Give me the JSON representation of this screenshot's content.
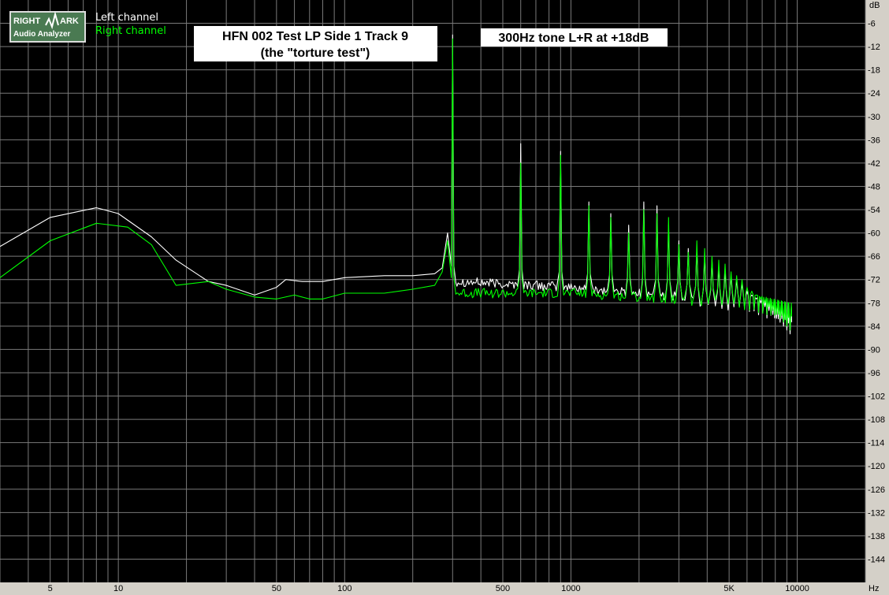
{
  "logo": {
    "line1_left": "RIGHT",
    "line1_right": "ARK",
    "line2": "Audio Analyzer"
  },
  "chart_data": {
    "type": "line",
    "xscale": "log",
    "xlim": [
      3,
      20000
    ],
    "ylim": [
      -150,
      0
    ],
    "x_unit": "Hz",
    "y_unit": "dB",
    "x_tick_labels": [
      {
        "value": 5,
        "label": "5"
      },
      {
        "value": 10,
        "label": "10"
      },
      {
        "value": 50,
        "label": "50"
      },
      {
        "value": 100,
        "label": "100"
      },
      {
        "value": 500,
        "label": "500"
      },
      {
        "value": 1000,
        "label": "1000"
      },
      {
        "value": 5000,
        "label": "5K"
      },
      {
        "value": 10000,
        "label": "10000"
      }
    ],
    "y_ticks": [
      -6,
      -12,
      -18,
      -24,
      -30,
      -36,
      -42,
      -48,
      -54,
      -60,
      -66,
      -72,
      -78,
      -84,
      -90,
      -96,
      -102,
      -108,
      -114,
      -120,
      -126,
      -132,
      -138,
      -144
    ],
    "grid": true,
    "legend_position": "top-left",
    "annotations": [
      {
        "line1": "HFN 002 Test LP Side 1 Track 9",
        "line2": "(the \"torture test\")"
      },
      {
        "line1": "300Hz tone L+R at +18dB"
      }
    ],
    "colors": {
      "background": "#000000",
      "grid": "#7a7a7a",
      "frame": "#d4d0c8",
      "left": "#ffffff",
      "right": "#00ff00",
      "logo_bg": "#4a7a52"
    },
    "fundamental_hz": 300,
    "series": [
      {
        "name": "Left channel",
        "color": "#ffffff",
        "points": [
          [
            3,
            -63.5
          ],
          [
            5,
            -56
          ],
          [
            8,
            -53.5
          ],
          [
            10,
            -55
          ],
          [
            14,
            -61
          ],
          [
            18,
            -67
          ],
          [
            25,
            -72.5
          ],
          [
            30,
            -73.5
          ],
          [
            40,
            -76
          ],
          [
            50,
            -74
          ],
          [
            55,
            -72
          ],
          [
            65,
            -72.5
          ],
          [
            80,
            -72.5
          ],
          [
            100,
            -71.5
          ],
          [
            150,
            -71
          ],
          [
            200,
            -71
          ],
          [
            250,
            -70.5
          ],
          [
            270,
            -69
          ],
          [
            285,
            -60
          ]
        ],
        "peaks": [
          -9,
          -37,
          -39,
          -52,
          -55,
          -58,
          -52,
          -53,
          -58,
          -62,
          -64,
          -64,
          -66,
          -67,
          -69,
          -70,
          -71,
          -72,
          -73,
          -75,
          -76,
          -77,
          -78,
          -79,
          -80,
          -81,
          -82,
          -83,
          -84,
          -85,
          -86
        ],
        "noise_floor": [
          [
            320,
            -72.5
          ],
          [
            1000,
            -74
          ],
          [
            2000,
            -75.5
          ],
          [
            3000,
            -76.5
          ],
          [
            4000,
            -78.5
          ],
          [
            6000,
            -80
          ],
          [
            10000,
            -83.5
          ],
          [
            14000,
            -89
          ],
          [
            18000,
            -95
          ],
          [
            20000,
            -99.5
          ]
        ]
      },
      {
        "name": "Right channel",
        "color": "#00ff00",
        "points": [
          [
            3,
            -71.5
          ],
          [
            5,
            -62
          ],
          [
            8,
            -57.5
          ],
          [
            11,
            -58.5
          ],
          [
            14,
            -63
          ],
          [
            18,
            -73.5
          ],
          [
            25,
            -72.5
          ],
          [
            30,
            -74.5
          ],
          [
            40,
            -76.5
          ],
          [
            50,
            -77
          ],
          [
            60,
            -76
          ],
          [
            70,
            -77
          ],
          [
            80,
            -77
          ],
          [
            100,
            -75.5
          ],
          [
            150,
            -75.5
          ],
          [
            200,
            -74.5
          ],
          [
            250,
            -73.5
          ],
          [
            270,
            -70
          ],
          [
            285,
            -62
          ]
        ],
        "peaks": [
          -10,
          -42,
          -40,
          -53,
          -56,
          -60,
          -54,
          -55,
          -56,
          -63,
          -65,
          -62,
          -64,
          -66,
          -67,
          -68,
          -70,
          -71,
          -72,
          -74,
          -75,
          -76,
          -77,
          -78,
          -79,
          -80,
          -81,
          -82,
          -83,
          -84,
          -85
        ],
        "noise_floor": [
          [
            320,
            -75.5
          ],
          [
            1000,
            -75.5
          ],
          [
            2000,
            -76.5
          ],
          [
            3000,
            -77
          ],
          [
            4000,
            -78
          ],
          [
            6000,
            -79.5
          ],
          [
            10000,
            -82.5
          ],
          [
            14000,
            -87.5
          ],
          [
            18000,
            -94
          ],
          [
            20000,
            -99
          ]
        ]
      }
    ]
  }
}
